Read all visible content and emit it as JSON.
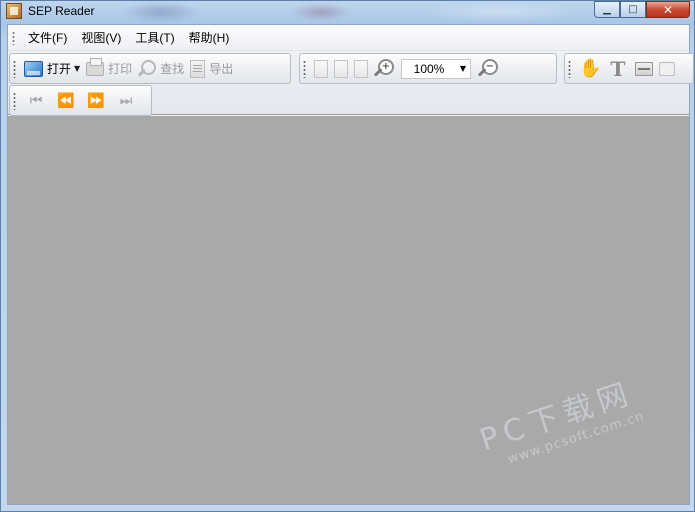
{
  "window": {
    "title": "SEP Reader",
    "controls": {
      "minimize": "▁",
      "maximize": "□",
      "close": "✕"
    }
  },
  "menu": {
    "items": [
      {
        "label": "文件(F)"
      },
      {
        "label": "视图(V)"
      },
      {
        "label": "工具(T)"
      },
      {
        "label": "帮助(H)"
      }
    ]
  },
  "toolbar_main": {
    "open": {
      "label": "打开",
      "icon": "open-folder-icon"
    },
    "print": {
      "label": "打印",
      "icon": "printer-icon"
    },
    "find": {
      "label": "查找",
      "icon": "search-icon"
    },
    "export": {
      "label": "导出",
      "icon": "export-icon"
    }
  },
  "toolbar_view": {
    "zoom_value": "100%",
    "zoom_in_sign": "+",
    "zoom_out_sign": "−"
  },
  "toolbar_tools": {
    "hand_glyph": "✋",
    "text_glyph": "T"
  },
  "toolbar_nav": {
    "first": "⏮",
    "prev": "⏪",
    "next": "⏩",
    "last": "⏭"
  },
  "watermark": {
    "main": "PC下载网",
    "sub": "www.pcsoft.com.cn"
  },
  "colors": {
    "document_background": "#a9a9a9",
    "window_frame": "#bfd6ee",
    "close_button": "#c94b33"
  }
}
